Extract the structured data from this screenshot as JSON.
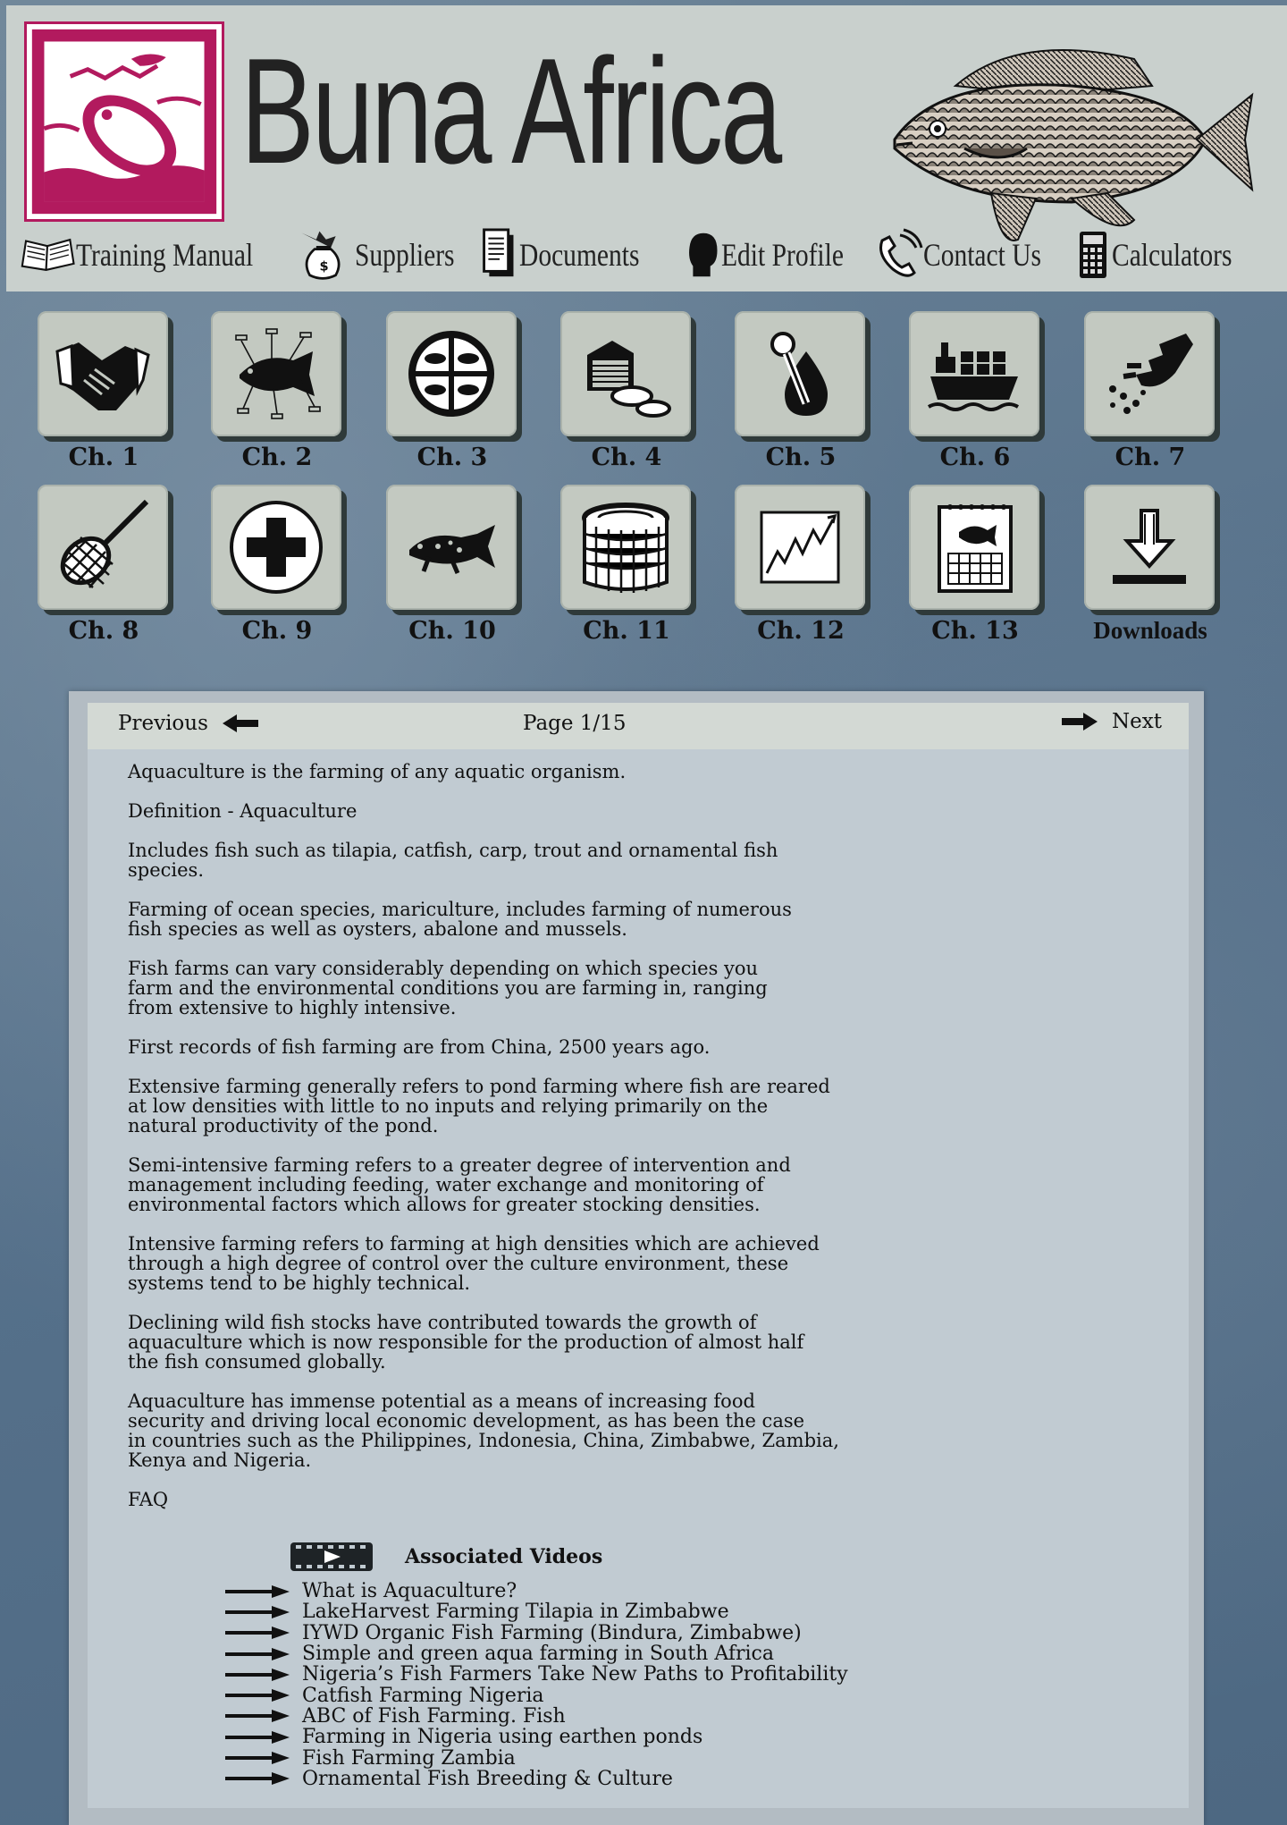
{
  "header": {
    "title": "Buna Africa"
  },
  "nav": [
    {
      "label": "Training Manual",
      "icon": "book-icon"
    },
    {
      "label": "Suppliers",
      "icon": "money-bag-icon"
    },
    {
      "label": "Documents",
      "icon": "document-icon"
    },
    {
      "label": "Edit Profile",
      "icon": "profile-head-icon"
    },
    {
      "label": "Contact Us",
      "icon": "telephone-icon"
    },
    {
      "label": "Calculators",
      "icon": "calculator-icon"
    }
  ],
  "chapters": [
    {
      "label": "Ch. 1",
      "icon": "handshake-icon"
    },
    {
      "label": "Ch. 2",
      "icon": "fish-anatomy-icon"
    },
    {
      "label": "Ch. 3",
      "icon": "fish-species-wheel-icon"
    },
    {
      "label": "Ch. 4",
      "icon": "hatchery-tanks-icon"
    },
    {
      "label": "Ch. 5",
      "icon": "thermometer-water-drop-icon"
    },
    {
      "label": "Ch. 6",
      "icon": "cargo-ship-icon"
    },
    {
      "label": "Ch. 7",
      "icon": "hand-feeding-pellets-icon"
    },
    {
      "label": "Ch. 8",
      "icon": "fishing-net-icon"
    },
    {
      "label": "Ch. 9",
      "icon": "medical-cross-icon"
    },
    {
      "label": "Ch. 10",
      "icon": "diseased-fish-icon"
    },
    {
      "label": "Ch. 11",
      "icon": "fish-cage-icon"
    },
    {
      "label": "Ch. 12",
      "icon": "line-chart-icon"
    },
    {
      "label": "Ch. 13",
      "icon": "fish-calendar-icon"
    },
    {
      "label": "Downloads",
      "icon": "download-icon"
    }
  ],
  "pager": {
    "previous": "Previous",
    "page": "Page 1/15",
    "next": "Next"
  },
  "content": {
    "paragraphs": [
      "Aquaculture is the farming of any aquatic organism.",
      "Definition - Aquaculture",
      "Includes fish such as tilapia, catfish, carp, trout and ornamental fish\nspecies.",
      "Farming of ocean species, mariculture, includes farming of numerous\nfish species as well as oysters, abalone and mussels.",
      "Fish farms can vary considerably depending on which species you\nfarm and the environmental conditions you are farming in, ranging\nfrom extensive to highly intensive.",
      "First records of fish farming are from China, 2500 years ago.",
      "Extensive farming generally refers to pond farming where fish are reared\n at low  densities with little to no inputs and relying primarily on the\nnatural productivity of the pond.",
      "Semi-intensive farming refers to a greater degree of intervention and\nmanagement including feeding, water exchange and monitoring of\nenvironmental factors which allows for greater stocking densities.",
      "Intensive farming refers to farming at high densities which are achieved\nthrough a high degree of control over the culture environment, these\nsystems tend to be highly technical.",
      "Declining wild fish stocks have contributed towards the growth of\naquaculture which is now responsible for the production of almost half\nthe fish consumed globally.",
      "Aquaculture has immense potential as a means of increasing food\nsecurity and driving local economic development, as has been the case\nin countries such as the Philippines, Indonesia, China, Zimbabwe, Zambia,\nKenya and Nigeria.",
      "FAQ"
    ]
  },
  "videos": {
    "heading": "Associated Videos",
    "items": [
      "What is Aquaculture?",
      "LakeHarvest Farming Tilapia in Zimbabwe",
      "IYWD Organic Fish Farming (Bindura, Zimbabwe)",
      "Simple and green aqua farming in South Africa",
      "Nigeria’s Fish Farmers Take New Paths to Profitability",
      "Catfish Farming Nigeria",
      "ABC of Fish Farming. Fish",
      "Farming in Nigeria using  earthen ponds",
      "Fish Farming Zambia",
      "Ornamental Fish Breeding & Culture"
    ]
  },
  "colors": {
    "logo_accent": "#b21a5e",
    "header_bg": "#c9d0cd",
    "page_bg": "#5d7588",
    "tile_bg": "#c3c9c1"
  }
}
